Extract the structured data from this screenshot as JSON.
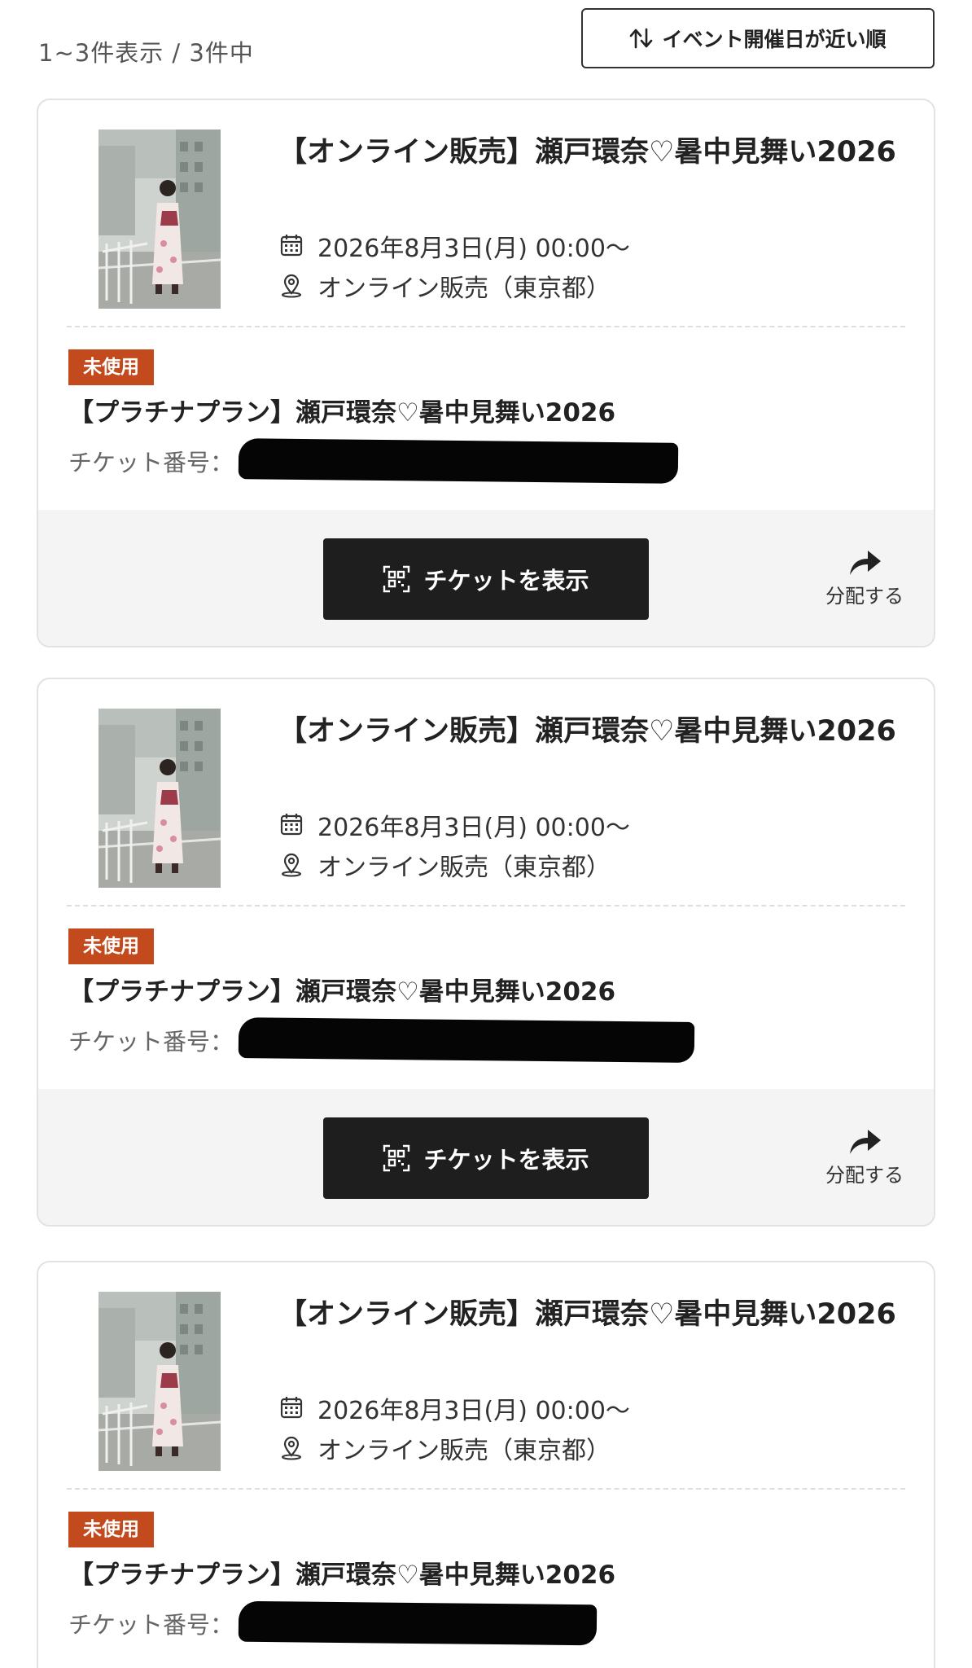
{
  "header": {
    "result_count": "1~3件表示 / 3件中",
    "sort_label": "イベント開催日が近い順"
  },
  "cards": [
    {
      "title": "【オンライン販売】瀬戸環奈♡暑中見舞い2026",
      "date": "2026年8月3日(月) 00:00〜",
      "location": "オンライン販売（東京都）",
      "status_badge": "未使用",
      "plan_name": "【プラチナプラン】瀬戸環奈♡暑中見舞い2026",
      "ticket_number_label": "チケット番号：",
      "show_ticket_label": "チケットを表示",
      "share_label": "分配する"
    },
    {
      "title": "【オンライン販売】瀬戸環奈♡暑中見舞い2026",
      "date": "2026年8月3日(月) 00:00〜",
      "location": "オンライン販売（東京都）",
      "status_badge": "未使用",
      "plan_name": "【プラチナプラン】瀬戸環奈♡暑中見舞い2026",
      "ticket_number_label": "チケット番号：",
      "show_ticket_label": "チケットを表示",
      "share_label": "分配する"
    },
    {
      "title": "【オンライン販売】瀬戸環奈♡暑中見舞い2026",
      "date": "2026年8月3日(月) 00:00〜",
      "location": "オンライン販売（東京都）",
      "status_badge": "未使用",
      "plan_name": "【プラチナプラン】瀬戸環奈♡暑中見舞い2026",
      "ticket_number_label": "チケット番号："
    }
  ],
  "colors": {
    "badge": "#c24a1c",
    "button": "#1e1e1e",
    "footer_bg": "#f4f4f4"
  }
}
